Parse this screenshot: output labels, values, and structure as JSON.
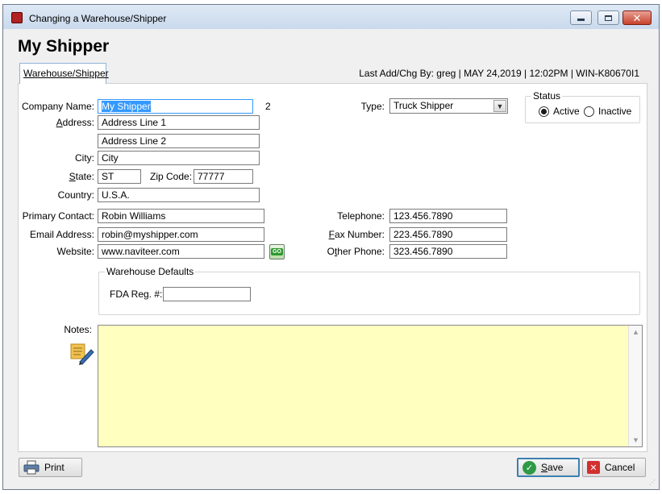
{
  "window": {
    "title": "Changing a Warehouse/Shipper",
    "icons": {
      "app": "app-icon",
      "minimize": "minimize-icon",
      "maximize": "maximize-icon",
      "close": "close-icon"
    }
  },
  "heading": "My Shipper",
  "tab": {
    "label": "Warehouse/Shipper"
  },
  "last_change": "Last Add/Chg By: greg | MAY 24,2019 | 12:02PM | WIN-K80670I1",
  "form": {
    "company_name": {
      "label": "Company Name:",
      "value": "My Shipper"
    },
    "record_number": "2",
    "address": {
      "label_pre": "",
      "label_ul": "A",
      "label_post": "ddress:",
      "line1": "Address Line 1",
      "line2": "Address Line 2"
    },
    "city": {
      "label": "City:",
      "value": "City"
    },
    "state": {
      "label_ul": "S",
      "label_post": "tate:",
      "value": "ST"
    },
    "zip": {
      "label": "Zip Code:",
      "value": "77777"
    },
    "country": {
      "label": "Country:",
      "value": "U.S.A."
    },
    "primary_contact": {
      "label": "Primary Contact:",
      "value": "Robin Williams"
    },
    "email": {
      "label": "Email Address:",
      "value": "robin@myshipper.com"
    },
    "website": {
      "label": "Website:",
      "value": "www.naviteer.com",
      "go_label": "GO"
    },
    "type": {
      "label": "Type:",
      "value": "Truck Shipper"
    },
    "telephone": {
      "label": "Telephone:",
      "value": "123.456.7890"
    },
    "fax": {
      "label_ul": "F",
      "label_post": "ax Number:",
      "value": "223.456.7890"
    },
    "other_phone": {
      "label_pre": "O",
      "label_ul": "t",
      "label_post": "her Phone:",
      "value": "323.456.7890"
    },
    "status": {
      "legend": "Status",
      "options": [
        "Active",
        "Inactive"
      ],
      "selected": "Active"
    },
    "warehouse_defaults": {
      "legend": "Warehouse Defaults",
      "fda_label": "FDA Reg. #:",
      "fda_value": ""
    },
    "notes": {
      "label": "Notes:",
      "value": "",
      "icon": "notes-edit-icon"
    }
  },
  "buttons": {
    "print": "Print",
    "save_ul": "S",
    "save_post": "ave",
    "cancel": "Cancel"
  },
  "colors": {
    "notes_bg": "#ffffc0",
    "accent": "#3399ff",
    "save_icon": "#2e9a47",
    "cancel_icon": "#d32f2f"
  }
}
